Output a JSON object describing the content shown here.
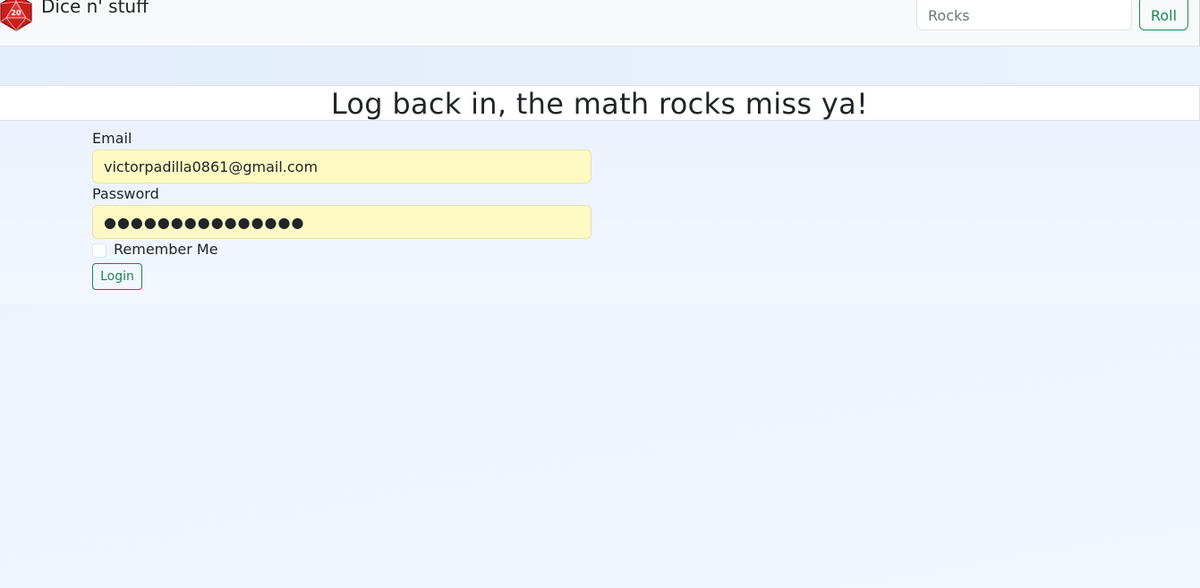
{
  "navbar": {
    "brand_text": "Dice n' stuff",
    "logo_number": "20",
    "search_placeholder": "Rocks",
    "roll_label": "Roll"
  },
  "page": {
    "title": "Log back in, the math rocks miss ya!"
  },
  "form": {
    "email_label": "Email",
    "email_value": "victorpadilla0861@gmail.com",
    "password_label": "Password",
    "password_masked": "●●●●●●●●●●●●●●●",
    "remember_label": "Remember Me",
    "remember_checked": false,
    "login_label": "Login"
  },
  "colors": {
    "accent_green": "#198754",
    "autofill_yellow": "#fff9c4",
    "logo_red": "#c9201f"
  }
}
